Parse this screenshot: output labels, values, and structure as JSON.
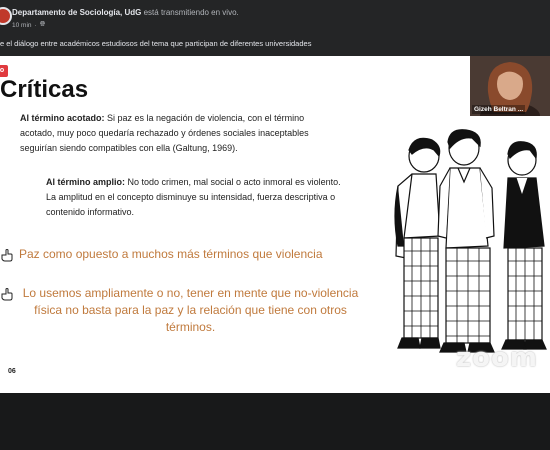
{
  "post": {
    "page_name": "Departamento de Sociología, UdG",
    "live_text": "está transmitiendo en vivo.",
    "time": "10 min",
    "description": "e el diálogo entre académicos estudiosos del tema que participan de diferentes universidades"
  },
  "slide": {
    "tag": "o",
    "title": "Críticas",
    "p1_label": "Al término acotado:",
    "p1_text": " Si paz es la negación de violencia, con el término acotado, muy poco quedaría rechazado y órdenes sociales inaceptables seguirían siendo compatibles con ella (Galtung, 1969).",
    "p2_label": "Al término amplio:",
    "p2_text": " No todo crimen, mal social o acto inmoral es violento. La amplitud en el concepto disminuye su intensidad, fuerza descriptiva o contenido informativo.",
    "bullet1": "Paz como opuesto a muchos más términos que violencia",
    "bullet2": "Lo usemos ampliamente o no, tener en mente que no-violencia física no basta para la paz y la relación que tiene con otros términos.",
    "number": "06",
    "watermark": "zoom"
  },
  "video": {
    "participant": "Gizeh Beltran ..."
  },
  "colors": {
    "accent": "#c07a3d",
    "tag": "#e03a3e",
    "background": "#242526"
  }
}
